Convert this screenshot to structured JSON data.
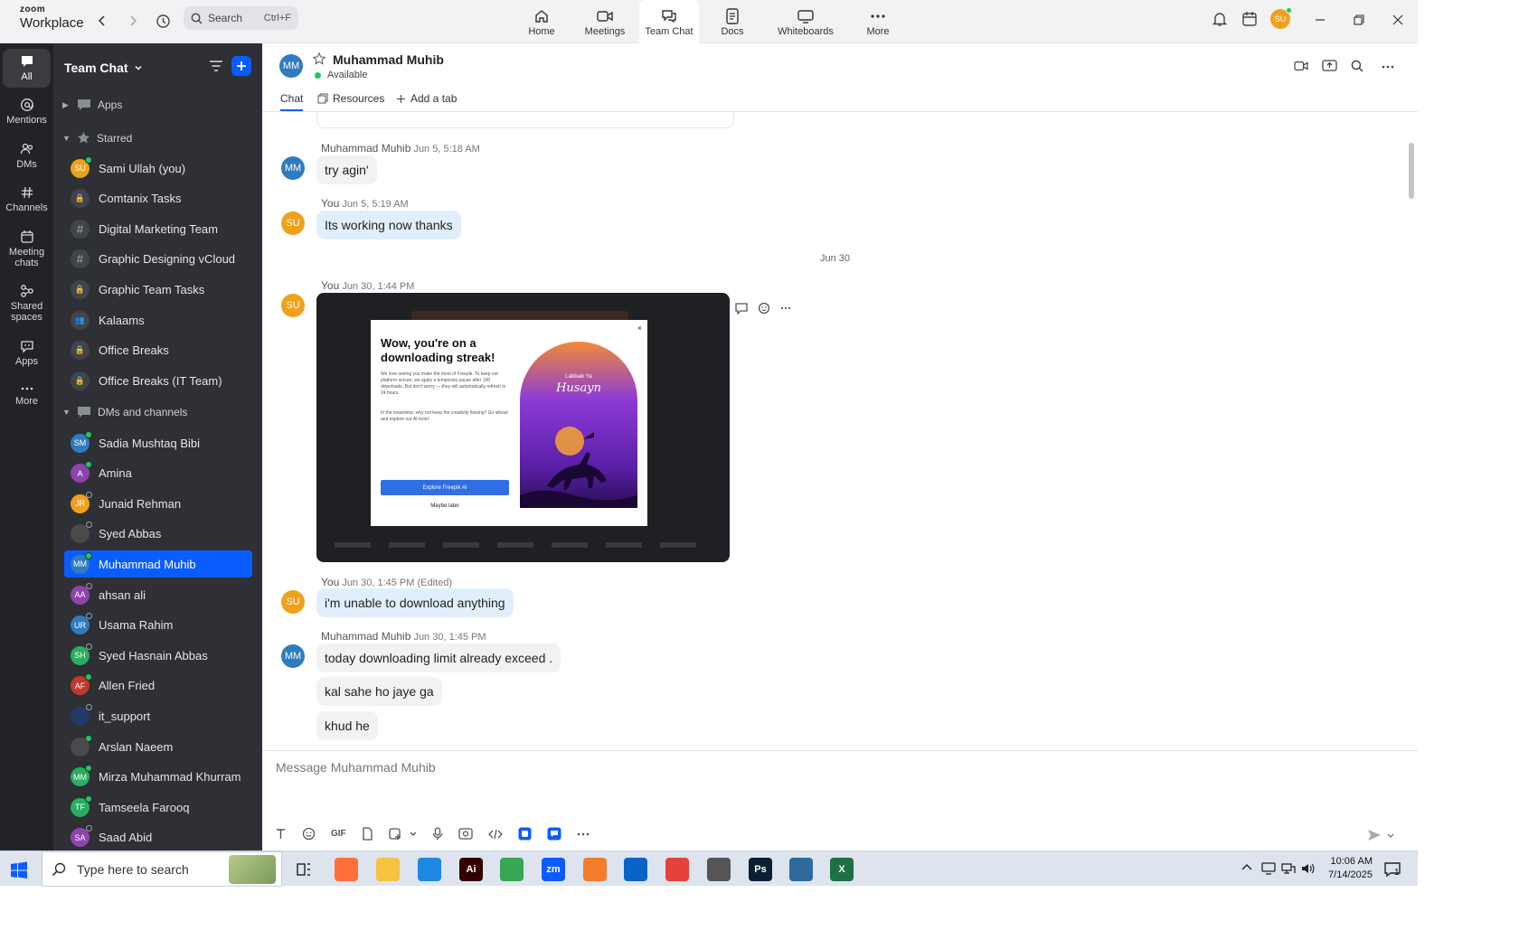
{
  "app": {
    "brand_top": "zoom",
    "brand_bottom": "Workplace"
  },
  "search": {
    "label": "Search",
    "shortcut": "Ctrl+F"
  },
  "top_tabs": [
    {
      "label": "Home",
      "icon": "home-icon"
    },
    {
      "label": "Meetings",
      "icon": "video-icon"
    },
    {
      "label": "Team Chat",
      "icon": "chat-icon"
    },
    {
      "label": "Docs",
      "icon": "doc-icon"
    },
    {
      "label": "Whiteboards",
      "icon": "whiteboard-icon"
    },
    {
      "label": "More",
      "icon": "more-icon"
    }
  ],
  "user": {
    "initials": "SU"
  },
  "rail": [
    {
      "label": "All"
    },
    {
      "label": "Mentions"
    },
    {
      "label": "DMs"
    },
    {
      "label": "Channels"
    },
    {
      "label": "Meeting chats"
    },
    {
      "label": "Shared spaces"
    },
    {
      "label": "Apps"
    },
    {
      "label": "More"
    }
  ],
  "sidebar": {
    "title": "Team Chat",
    "apps_label": "Apps",
    "starred_label": "Starred",
    "dms_label": "DMs and channels",
    "starred": [
      {
        "initials": "SU",
        "name": "Sami Ullah (you)",
        "color": "#f0a11b",
        "kind": "user",
        "status": "on"
      },
      {
        "initials": "",
        "name": "Comtanix Tasks",
        "kind": "lock"
      },
      {
        "initials": "",
        "name": "Digital Marketing Team",
        "kind": "hash"
      },
      {
        "initials": "",
        "name": "Graphic Designing vCloud",
        "kind": "hash"
      },
      {
        "initials": "",
        "name": "Graphic Team Tasks",
        "kind": "lock"
      },
      {
        "initials": "",
        "name": "Kalaams",
        "kind": "group"
      },
      {
        "initials": "",
        "name": "Office Breaks",
        "kind": "lock"
      },
      {
        "initials": "",
        "name": "Office Breaks (IT Team)",
        "kind": "lock"
      }
    ],
    "dms": [
      {
        "initials": "SM",
        "name": "Sadia Mushtaq Bibi",
        "color": "#2f7bbf",
        "status": "on"
      },
      {
        "initials": "A",
        "name": "Amina",
        "color": "#8e44ad",
        "status": "on"
      },
      {
        "initials": "JR",
        "name": "Junaid Rehman",
        "color": "#f0a11b",
        "status": "off"
      },
      {
        "initials": "",
        "name": "Syed Abbas",
        "color": "#4a4a4a",
        "status": "off"
      },
      {
        "initials": "MM",
        "name": "Muhammad Muhib",
        "color": "#2f7bbf",
        "status": "on"
      },
      {
        "initials": "AA",
        "name": "ahsan ali",
        "color": "#8e44ad",
        "status": "off"
      },
      {
        "initials": "UR",
        "name": "Usama Rahim",
        "color": "#2f7bbf",
        "status": "off"
      },
      {
        "initials": "SH",
        "name": "Syed Hasnain Abbas",
        "color": "#27ae60",
        "status": "off"
      },
      {
        "initials": "AF",
        "name": "Allen Fried",
        "color": "#c0392b",
        "status": "on"
      },
      {
        "initials": "",
        "name": "it_support",
        "color": "#1f3b66",
        "status": "off"
      },
      {
        "initials": "",
        "name": "Arslan Naeem",
        "color": "#4a4a4a",
        "status": "on"
      },
      {
        "initials": "MM",
        "name": "Mirza Muhammad Khurram",
        "color": "#27ae60",
        "status": "on"
      },
      {
        "initials": "TF",
        "name": "Tamseela Farooq",
        "color": "#27ae60",
        "status": "on"
      },
      {
        "initials": "SA",
        "name": "Saad Abid",
        "color": "#8e44ad",
        "status": "off"
      }
    ]
  },
  "chat": {
    "contact_initials": "MM",
    "contact_name": "Muhammad Muhib",
    "status": "Available",
    "tabs": [
      "Chat",
      "Resources",
      "Add a tab"
    ],
    "date_separator": "Jun 30",
    "messages": [
      {
        "sender": "Muhammad Muhib",
        "time": "Jun 5, 5:18 AM",
        "text": "try agin'"
      },
      {
        "sender": "You",
        "time": "Jun 5, 5:19 AM",
        "text": "Its working now thanks"
      },
      {
        "sender": "You",
        "time": "Jun 30, 1:44 PM"
      },
      {
        "sender": "You",
        "time": "Jun 30, 1:45 PM (Edited)",
        "text": "i'm unable to download anything"
      },
      {
        "sender": "Muhammad Muhib",
        "time": "Jun 30, 1:45 PM",
        "texts": [
          "today downloading limit already exceed .",
          "kal sahe ho jaye ga",
          "khud he"
        ]
      }
    ],
    "image": {
      "title": "Wow, you're on a downloading streak!",
      "body1": "We love seeing you make the most of Freepik. To keep our platform secure, we apply a temporary pause after 100 downloads. But don't worry — they will automatically refresh in 24 hours.",
      "body2": "In the meantime, why not keep the creativity flowing? Go ahead and explore our AI tools!",
      "button": "Explore Freepik AI",
      "later": "Maybe later",
      "close": "×",
      "poster_small": "Labbaik Ya",
      "poster_big": "Husayn"
    },
    "composer_placeholder": "Message Muhammad Muhib",
    "gif_label": "GIF"
  },
  "taskbar": {
    "search_placeholder": "Type here to search",
    "time": "10:06 AM",
    "date": "7/14/2025",
    "notif_count": "1",
    "apps": [
      {
        "name": "firefox",
        "label": "",
        "color": "#ff7139"
      },
      {
        "name": "file-explorer",
        "label": "",
        "color": "#f5c242"
      },
      {
        "name": "vscode",
        "label": "",
        "color": "#1e88e5"
      },
      {
        "name": "illustrator",
        "label": "Ai",
        "color": "#330000"
      },
      {
        "name": "chrome",
        "label": "",
        "color": "#34a853"
      },
      {
        "name": "zoom",
        "label": "zm",
        "color": "#0b5cff"
      },
      {
        "name": "xampp",
        "label": "",
        "color": "#f57c2b"
      },
      {
        "name": "outlook",
        "label": "",
        "color": "#0a64c8"
      },
      {
        "name": "creative-cloud",
        "label": "",
        "color": "#e8403a"
      },
      {
        "name": "pen-tool",
        "label": "",
        "color": "#555555"
      },
      {
        "name": "photoshop",
        "label": "Ps",
        "color": "#0a1f33"
      },
      {
        "name": "app-blue",
        "label": "",
        "color": "#2e6a9e"
      },
      {
        "name": "excel",
        "label": "X",
        "color": "#1d7044"
      }
    ]
  }
}
